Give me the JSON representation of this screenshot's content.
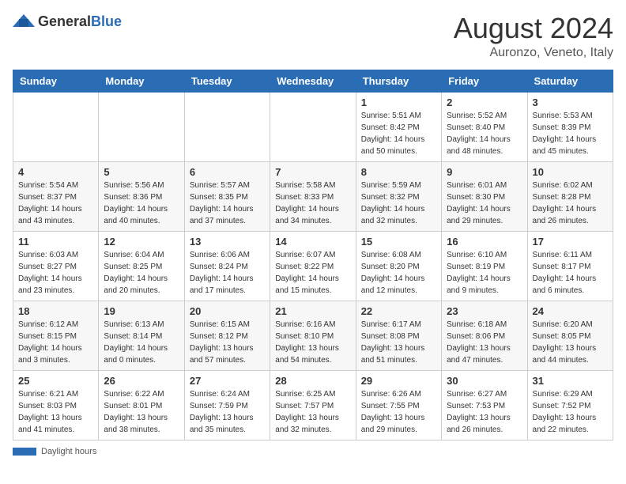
{
  "header": {
    "logo_general": "General",
    "logo_blue": "Blue",
    "month_year": "August 2024",
    "location": "Auronzo, Veneto, Italy"
  },
  "days_of_week": [
    "Sunday",
    "Monday",
    "Tuesday",
    "Wednesday",
    "Thursday",
    "Friday",
    "Saturday"
  ],
  "weeks": [
    [
      {
        "day": "",
        "info": ""
      },
      {
        "day": "",
        "info": ""
      },
      {
        "day": "",
        "info": ""
      },
      {
        "day": "",
        "info": ""
      },
      {
        "day": "1",
        "info": "Sunrise: 5:51 AM\nSunset: 8:42 PM\nDaylight: 14 hours and 50 minutes."
      },
      {
        "day": "2",
        "info": "Sunrise: 5:52 AM\nSunset: 8:40 PM\nDaylight: 14 hours and 48 minutes."
      },
      {
        "day": "3",
        "info": "Sunrise: 5:53 AM\nSunset: 8:39 PM\nDaylight: 14 hours and 45 minutes."
      }
    ],
    [
      {
        "day": "4",
        "info": "Sunrise: 5:54 AM\nSunset: 8:37 PM\nDaylight: 14 hours and 43 minutes."
      },
      {
        "day": "5",
        "info": "Sunrise: 5:56 AM\nSunset: 8:36 PM\nDaylight: 14 hours and 40 minutes."
      },
      {
        "day": "6",
        "info": "Sunrise: 5:57 AM\nSunset: 8:35 PM\nDaylight: 14 hours and 37 minutes."
      },
      {
        "day": "7",
        "info": "Sunrise: 5:58 AM\nSunset: 8:33 PM\nDaylight: 14 hours and 34 minutes."
      },
      {
        "day": "8",
        "info": "Sunrise: 5:59 AM\nSunset: 8:32 PM\nDaylight: 14 hours and 32 minutes."
      },
      {
        "day": "9",
        "info": "Sunrise: 6:01 AM\nSunset: 8:30 PM\nDaylight: 14 hours and 29 minutes."
      },
      {
        "day": "10",
        "info": "Sunrise: 6:02 AM\nSunset: 8:28 PM\nDaylight: 14 hours and 26 minutes."
      }
    ],
    [
      {
        "day": "11",
        "info": "Sunrise: 6:03 AM\nSunset: 8:27 PM\nDaylight: 14 hours and 23 minutes."
      },
      {
        "day": "12",
        "info": "Sunrise: 6:04 AM\nSunset: 8:25 PM\nDaylight: 14 hours and 20 minutes."
      },
      {
        "day": "13",
        "info": "Sunrise: 6:06 AM\nSunset: 8:24 PM\nDaylight: 14 hours and 17 minutes."
      },
      {
        "day": "14",
        "info": "Sunrise: 6:07 AM\nSunset: 8:22 PM\nDaylight: 14 hours and 15 minutes."
      },
      {
        "day": "15",
        "info": "Sunrise: 6:08 AM\nSunset: 8:20 PM\nDaylight: 14 hours and 12 minutes."
      },
      {
        "day": "16",
        "info": "Sunrise: 6:10 AM\nSunset: 8:19 PM\nDaylight: 14 hours and 9 minutes."
      },
      {
        "day": "17",
        "info": "Sunrise: 6:11 AM\nSunset: 8:17 PM\nDaylight: 14 hours and 6 minutes."
      }
    ],
    [
      {
        "day": "18",
        "info": "Sunrise: 6:12 AM\nSunset: 8:15 PM\nDaylight: 14 hours and 3 minutes."
      },
      {
        "day": "19",
        "info": "Sunrise: 6:13 AM\nSunset: 8:14 PM\nDaylight: 14 hours and 0 minutes."
      },
      {
        "day": "20",
        "info": "Sunrise: 6:15 AM\nSunset: 8:12 PM\nDaylight: 13 hours and 57 minutes."
      },
      {
        "day": "21",
        "info": "Sunrise: 6:16 AM\nSunset: 8:10 PM\nDaylight: 13 hours and 54 minutes."
      },
      {
        "day": "22",
        "info": "Sunrise: 6:17 AM\nSunset: 8:08 PM\nDaylight: 13 hours and 51 minutes."
      },
      {
        "day": "23",
        "info": "Sunrise: 6:18 AM\nSunset: 8:06 PM\nDaylight: 13 hours and 47 minutes."
      },
      {
        "day": "24",
        "info": "Sunrise: 6:20 AM\nSunset: 8:05 PM\nDaylight: 13 hours and 44 minutes."
      }
    ],
    [
      {
        "day": "25",
        "info": "Sunrise: 6:21 AM\nSunset: 8:03 PM\nDaylight: 13 hours and 41 minutes."
      },
      {
        "day": "26",
        "info": "Sunrise: 6:22 AM\nSunset: 8:01 PM\nDaylight: 13 hours and 38 minutes."
      },
      {
        "day": "27",
        "info": "Sunrise: 6:24 AM\nSunset: 7:59 PM\nDaylight: 13 hours and 35 minutes."
      },
      {
        "day": "28",
        "info": "Sunrise: 6:25 AM\nSunset: 7:57 PM\nDaylight: 13 hours and 32 minutes."
      },
      {
        "day": "29",
        "info": "Sunrise: 6:26 AM\nSunset: 7:55 PM\nDaylight: 13 hours and 29 minutes."
      },
      {
        "day": "30",
        "info": "Sunrise: 6:27 AM\nSunset: 7:53 PM\nDaylight: 13 hours and 26 minutes."
      },
      {
        "day": "31",
        "info": "Sunrise: 6:29 AM\nSunset: 7:52 PM\nDaylight: 13 hours and 22 minutes."
      }
    ]
  ],
  "footer": {
    "daylight_label": "Daylight hours"
  }
}
